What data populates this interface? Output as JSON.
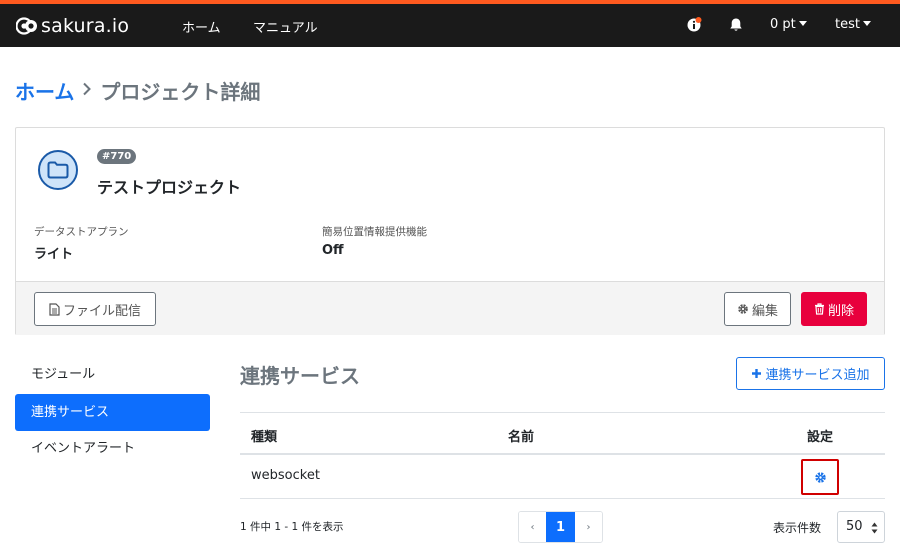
{
  "navbar": {
    "brand": "sakura.io",
    "home": "ホーム",
    "manual": "マニュアル",
    "points": "0 pt",
    "user": "test",
    "accent_color": "#ff5a1f"
  },
  "breadcrumb": {
    "home": "ホーム",
    "current": "プロジェクト詳細"
  },
  "project": {
    "id_badge": "#770",
    "name": "テストプロジェクト",
    "datastore_label": "データストアプラン",
    "datastore_value": "ライト",
    "location_label": "簡易位置情報提供機能",
    "location_value": "Off",
    "file_button": "ファイル配信",
    "edit_button": "編集",
    "delete_button": "削除"
  },
  "sidebar": {
    "items": [
      {
        "label": "モジュール"
      },
      {
        "label": "連携サービス"
      },
      {
        "label": "イベントアラート"
      }
    ]
  },
  "main": {
    "title": "連携サービス",
    "add_button": "連携サービス追加",
    "columns": [
      "種類",
      "名前",
      "設定"
    ],
    "rows": [
      {
        "type": "websocket",
        "name": ""
      }
    ],
    "count_text": "1 件中 1 - 1 件を表示",
    "pager": {
      "prev": "‹",
      "current": "1",
      "next": "›"
    },
    "per_page_label": "表示件数",
    "per_page_value": "50"
  },
  "colors": {
    "primary": "#0d6efd",
    "danger": "#e8003d",
    "highlight": "#d00000"
  }
}
